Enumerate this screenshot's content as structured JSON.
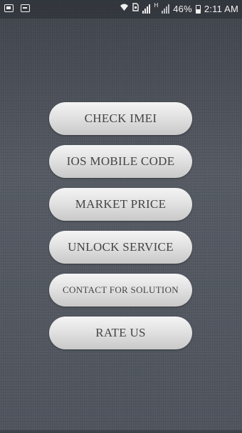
{
  "status_bar": {
    "icons": [
      "gallery-icon",
      "message-icon",
      "wifi-icon",
      "sim-icon",
      "signal-icon",
      "data-icon",
      "signal-icon",
      "battery-icon"
    ],
    "battery": "46%",
    "time": "2:11 AM",
    "data_label": "H"
  },
  "menu": {
    "buttons": [
      {
        "label": "CHECK IMEI"
      },
      {
        "label": "IOS MOBILE CODE"
      },
      {
        "label": "MARKET PRICE"
      },
      {
        "label": "UNLOCK SERVICE"
      },
      {
        "label": "CONTACT FOR SOLUTION"
      },
      {
        "label": "RATE US"
      }
    ]
  }
}
